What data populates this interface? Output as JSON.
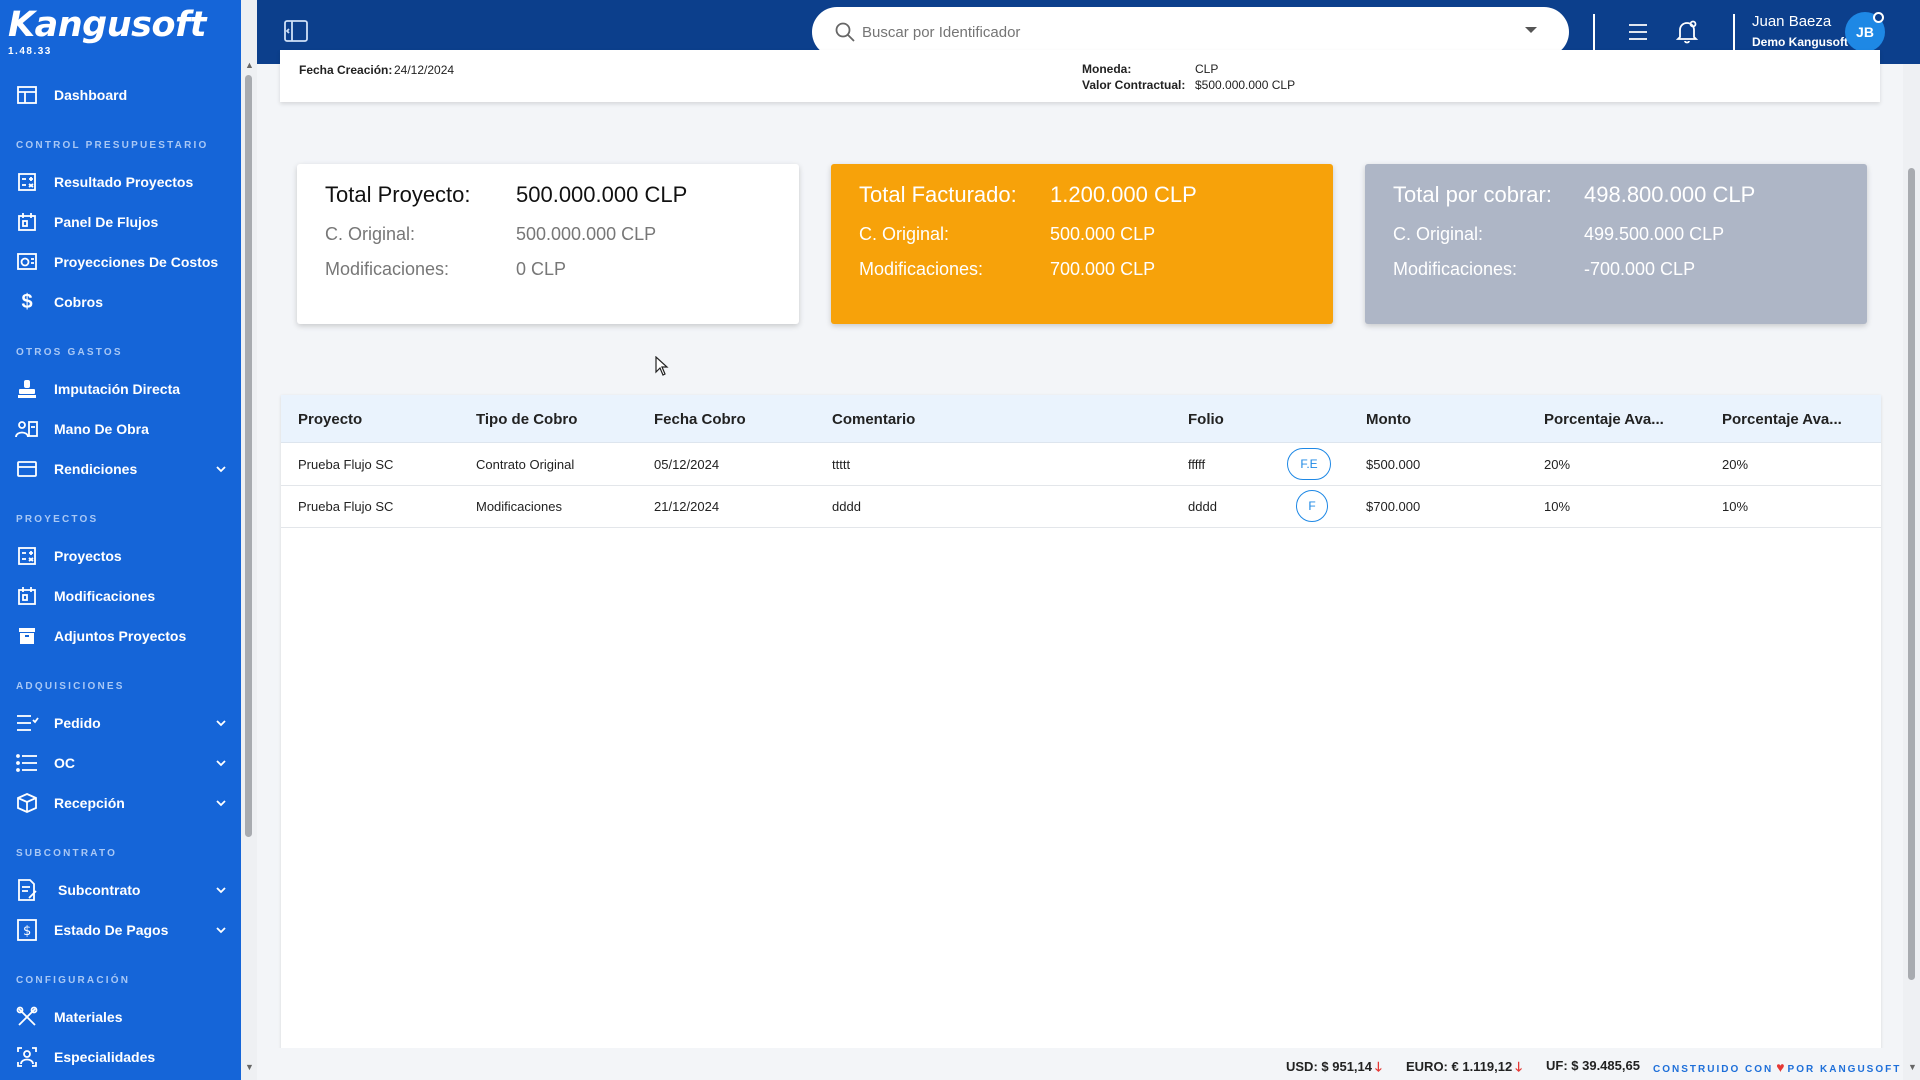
{
  "app": {
    "logo": "Kangusoft",
    "version": "1.48.33"
  },
  "sidebar": {
    "dashboard": "Dashboard",
    "sections": {
      "control": "CONTROL PRESUPUESTARIO",
      "otros": "OTROS GASTOS",
      "proyectos": "PROYECTOS",
      "adquisiciones": "ADQUISICIONES",
      "subcontrato": "SUBCONTRATO",
      "configuracion": "CONFIGURACIÓN"
    },
    "items": {
      "resultado_proyectos": "Resultado Proyectos",
      "panel_flujos": "Panel De Flujos",
      "proyecciones_costos": "Proyecciones De Costos",
      "cobros": "Cobros",
      "imputacion_directa": "Imputación Directa",
      "mano_obra": "Mano De Obra",
      "rendiciones": "Rendiciones",
      "proyectos": "Proyectos",
      "modificaciones": "Modificaciones",
      "adjuntos_proyectos": "Adjuntos Proyectos",
      "pedido": "Pedido",
      "oc": "OC",
      "recepcion": "Recepción",
      "subcontrato": "Subcontrato",
      "estado_pagos": "Estado De Pagos",
      "materiales": "Materiales",
      "especialidades": "Especialidades"
    }
  },
  "header": {
    "search_placeholder": "Buscar por Identificador",
    "user_name": "Juan Baeza",
    "user_company": "Demo Kangusoft",
    "avatar_initials": "JB"
  },
  "info": {
    "fecha_creacion_label": "Fecha Creación:",
    "fecha_creacion_value": "24/12/2024",
    "moneda_label": "Moneda:",
    "moneda_value": "CLP",
    "valor_label": "Valor Contractual:",
    "valor_value": "$500.000.000 CLP"
  },
  "summary": {
    "total_proyecto": {
      "title": "Total Proyecto:",
      "value": "500.000.000 CLP",
      "original_label": "C. Original:",
      "original_value": "500.000.000 CLP",
      "mod_label": "Modificaciones:",
      "mod_value": "0 CLP"
    },
    "total_facturado": {
      "title": "Total Facturado:",
      "value": "1.200.000 CLP",
      "original_label": "C. Original:",
      "original_value": "500.000 CLP",
      "mod_label": "Modificaciones:",
      "mod_value": "700.000 CLP"
    },
    "total_cobrar": {
      "title": "Total por cobrar:",
      "value": "498.800.000 CLP",
      "original_label": "C. Original:",
      "original_value": "499.500.000 CLP",
      "mod_label": "Modificaciones:",
      "mod_value": "-700.000 CLP"
    }
  },
  "table": {
    "columns": [
      "Proyecto",
      "Tipo de Cobro",
      "Fecha Cobro",
      "Comentario",
      "Folio",
      "Monto",
      "Porcentaje Ava...",
      "Porcentaje Ava..."
    ],
    "rows": [
      {
        "proyecto": "Prueba Flujo SC",
        "tipo": "Contrato Original",
        "fecha": "05/12/2024",
        "comentario": "ttttt",
        "folio": "fffff",
        "doc": "F.E",
        "monto": "$500.000",
        "pct1": "20%",
        "pct2": "20%"
      },
      {
        "proyecto": "Prueba Flujo SC",
        "tipo": "Modificaciones",
        "fecha": "21/12/2024",
        "comentario": "dddd",
        "folio": "dddd",
        "doc": "F",
        "monto": "$700.000",
        "pct1": "10%",
        "pct2": "10%"
      }
    ]
  },
  "footer": {
    "usd": "USD: $ 951,14",
    "euro": "EURO: € 1.119,12",
    "uf": "UF: $ 39.485,65",
    "built_pre": "CONSTRUIDO CON",
    "built_post": "POR KANGUSOFT"
  },
  "colors": {
    "sidebar": "#1565d8",
    "topbar": "#0c3f8c",
    "facturado": "#f7a20a",
    "por_cobrar": "#aeb6c6"
  }
}
